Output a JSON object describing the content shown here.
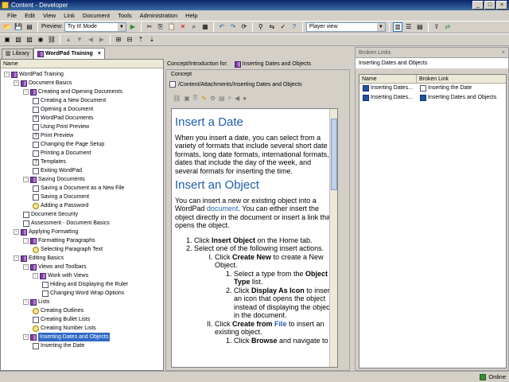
{
  "window": {
    "title": "Content - Developer",
    "min": "_",
    "max": "□",
    "close": "×"
  },
  "menu": [
    "File",
    "Edit",
    "View",
    "Link",
    "Document",
    "Tools",
    "Administration",
    "Help"
  ],
  "toolbar": {
    "preview_label": "Preview:",
    "preview_value": "Try It! Mode",
    "player_value": "Player view"
  },
  "left_tabs": {
    "library": "Library",
    "active": "WordPad Training"
  },
  "tree": {
    "header": "Name",
    "nodes": [
      {
        "label": "WordPad Training",
        "icon": "book",
        "depth": 0,
        "twisty": "-"
      },
      {
        "label": "Document Basics",
        "icon": "book",
        "depth": 1,
        "twisty": "-"
      },
      {
        "label": "Creating and Opening Documents",
        "icon": "book",
        "depth": 2,
        "twisty": "-"
      },
      {
        "label": "Creating a New Document",
        "icon": "page",
        "depth": 3
      },
      {
        "label": "Opening a Document",
        "icon": "page",
        "depth": 3
      },
      {
        "label": "WordPad Documents",
        "icon": "qpage",
        "depth": 3
      },
      {
        "label": "Using Print Preview",
        "icon": "page",
        "depth": 3
      },
      {
        "label": "Print Preview",
        "icon": "qpage",
        "depth": 3
      },
      {
        "label": "Changing the Page Setup",
        "icon": "page",
        "depth": 3
      },
      {
        "label": "Printing a Document",
        "icon": "page",
        "depth": 3
      },
      {
        "label": "Templates",
        "icon": "qpage",
        "depth": 3
      },
      {
        "label": "Exiting WordPad",
        "icon": "page",
        "depth": 3
      },
      {
        "label": "Saving Documents",
        "icon": "book",
        "depth": 2,
        "twisty": "-"
      },
      {
        "label": "Saving a Document as a New File",
        "icon": "page",
        "depth": 3
      },
      {
        "label": "Saving a Document",
        "icon": "page",
        "depth": 3
      },
      {
        "label": "Adding a Password",
        "icon": "hl",
        "depth": 3
      },
      {
        "label": "Document Security",
        "icon": "page",
        "depth": 2
      },
      {
        "label": "Assessment - Document Basics",
        "icon": "page",
        "depth": 2
      },
      {
        "label": "Applying Formatting",
        "icon": "book",
        "depth": 1,
        "twisty": "-"
      },
      {
        "label": "Formatting Paragraphs",
        "icon": "book",
        "depth": 2,
        "twisty": "-"
      },
      {
        "label": "Selecting Paragraph Text",
        "icon": "hl",
        "depth": 3
      },
      {
        "label": "Editing Basics",
        "icon": "book",
        "depth": 1,
        "twisty": "-"
      },
      {
        "label": "Views and Toolbars",
        "icon": "book",
        "depth": 2,
        "twisty": "-"
      },
      {
        "label": "Work with Views",
        "icon": "book",
        "depth": 3,
        "twisty": "-"
      },
      {
        "label": "Hiding and Displaying the Ruler",
        "icon": "page",
        "depth": 4
      },
      {
        "label": "Changing Word Wrap Options",
        "icon": "page",
        "depth": 4
      },
      {
        "label": "Lists",
        "icon": "book",
        "depth": 2,
        "twisty": "-"
      },
      {
        "label": "Creating Outlines",
        "icon": "hl",
        "depth": 3
      },
      {
        "label": "Creating Bullet Lists",
        "icon": "page",
        "depth": 3
      },
      {
        "label": "Creating Number Lists",
        "icon": "hl",
        "depth": 3
      },
      {
        "label": "Inserting Dates and Objects",
        "icon": "book",
        "depth": 2,
        "twisty": "-",
        "selected": true
      },
      {
        "label": "Inserting the Date",
        "icon": "page",
        "depth": 3
      }
    ]
  },
  "concept": {
    "header_label": "Concept/Introduction for:",
    "header_value": "Inserting Dates and Objects",
    "section_label": "Concept",
    "path": "/Content/Attachments/Inserting Dates and Objects"
  },
  "doc": {
    "h1": "Insert a Date",
    "p1": "When you insert a date, you can select from a variety of formats that include several short date formats, long date formats, international formats, dates that include the day of the week, and several formats for inserting the time.",
    "h2": "Insert an Object",
    "p2a": "You can insert a new or existing object into a WordPad ",
    "p2link": "document",
    "p2b": ". You can either insert the object directly in the document or insert a link that opens the object.",
    "s1a": "Click ",
    "s1b": "Insert Object",
    "s1c": " on the Home tab.",
    "s2": "Select one of the following insert actions.",
    "r1a": "Click ",
    "r1b": "Create New",
    "r1c": " to create a New Object.",
    "r1s1a": "Select a type from the ",
    "r1s1b": "Object Type",
    "r1s1c": " list.",
    "r1s2a": "Click ",
    "r1s2b": "Display As Icon",
    "r1s2c": " to insert an icon that opens the object instead of displaying the object in the document.",
    "r2a": "Click ",
    "r2b": "Create from ",
    "r2link": "File",
    "r2c": " to insert an existing object.",
    "r2s1a": "Click ",
    "r2s1b": "Browse",
    "r2s1c": " and navigate to"
  },
  "broken": {
    "title": "Broken Links",
    "close": "×",
    "subtitle": "Inserting Dates and Objects",
    "col_name": "Name",
    "col_link": "Broken Link",
    "rows": [
      {
        "name": "Inserting Dates...",
        "link": "Inserting the Date"
      },
      {
        "name": "Inserting Dates...",
        "link": "Inserting Dates and Objects"
      }
    ]
  },
  "status": {
    "online": "Online"
  }
}
